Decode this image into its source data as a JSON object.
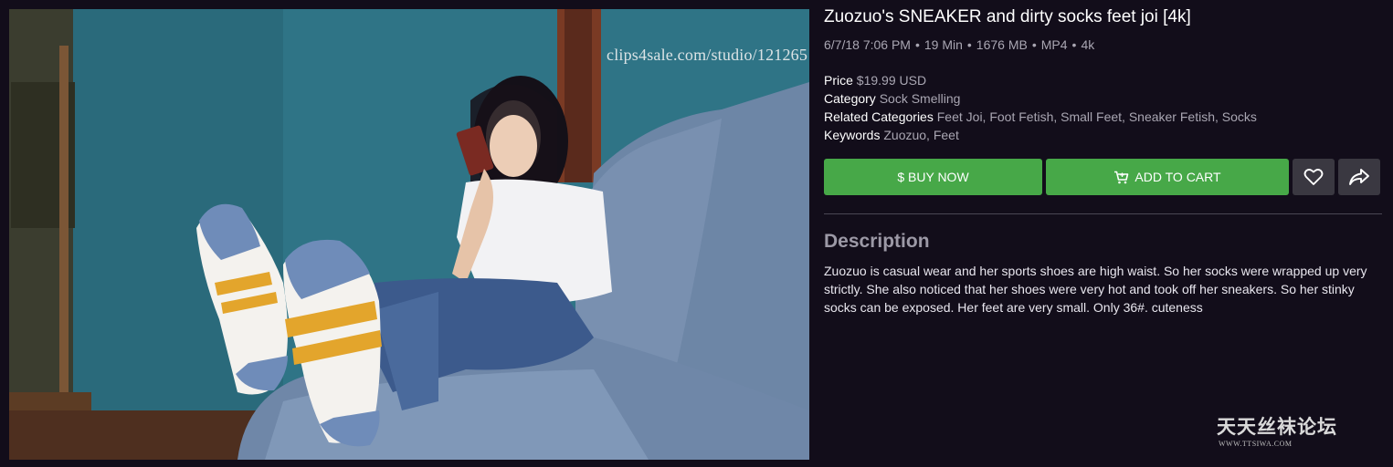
{
  "preview": {
    "watermark_url": "clips4sale.com/studio/121265"
  },
  "product": {
    "title": "Zuozuo's SNEAKER and dirty socks feet joi [4k]",
    "meta": {
      "date": "6/7/18 7:06 PM",
      "duration": "19 Min",
      "size": "1676 MB",
      "format": "MP4",
      "quality": "4k"
    },
    "price_label": "Price",
    "price_value": "$19.99 USD",
    "category_label": "Category",
    "category_value": "Sock Smelling",
    "related_label": "Related Categories",
    "related_value": "Feet Joi, Foot Fetish, Small Feet, Sneaker Fetish, Socks",
    "keywords_label": "Keywords",
    "keywords_value": "Zuozuo, Feet"
  },
  "actions": {
    "buy_label": "$ BUY NOW",
    "cart_label": "ADD TO CART",
    "cart_icon": "cart-icon",
    "favorite_icon": "heart-icon",
    "share_icon": "share-icon",
    "accent_color": "#47a848"
  },
  "description": {
    "heading": "Description",
    "text": "Zuozuo is casual wear and her sports shoes are high waist. So her socks were wrapped up very strictly. She also noticed that her shoes were very hot and took off her sneakers. So her stinky socks can be exposed. Her feet are very small. Only 36#. cuteness"
  },
  "forum_watermark": {
    "chinese": "天天丝袜论坛",
    "url": "WWW.TTSIWA.COM"
  }
}
